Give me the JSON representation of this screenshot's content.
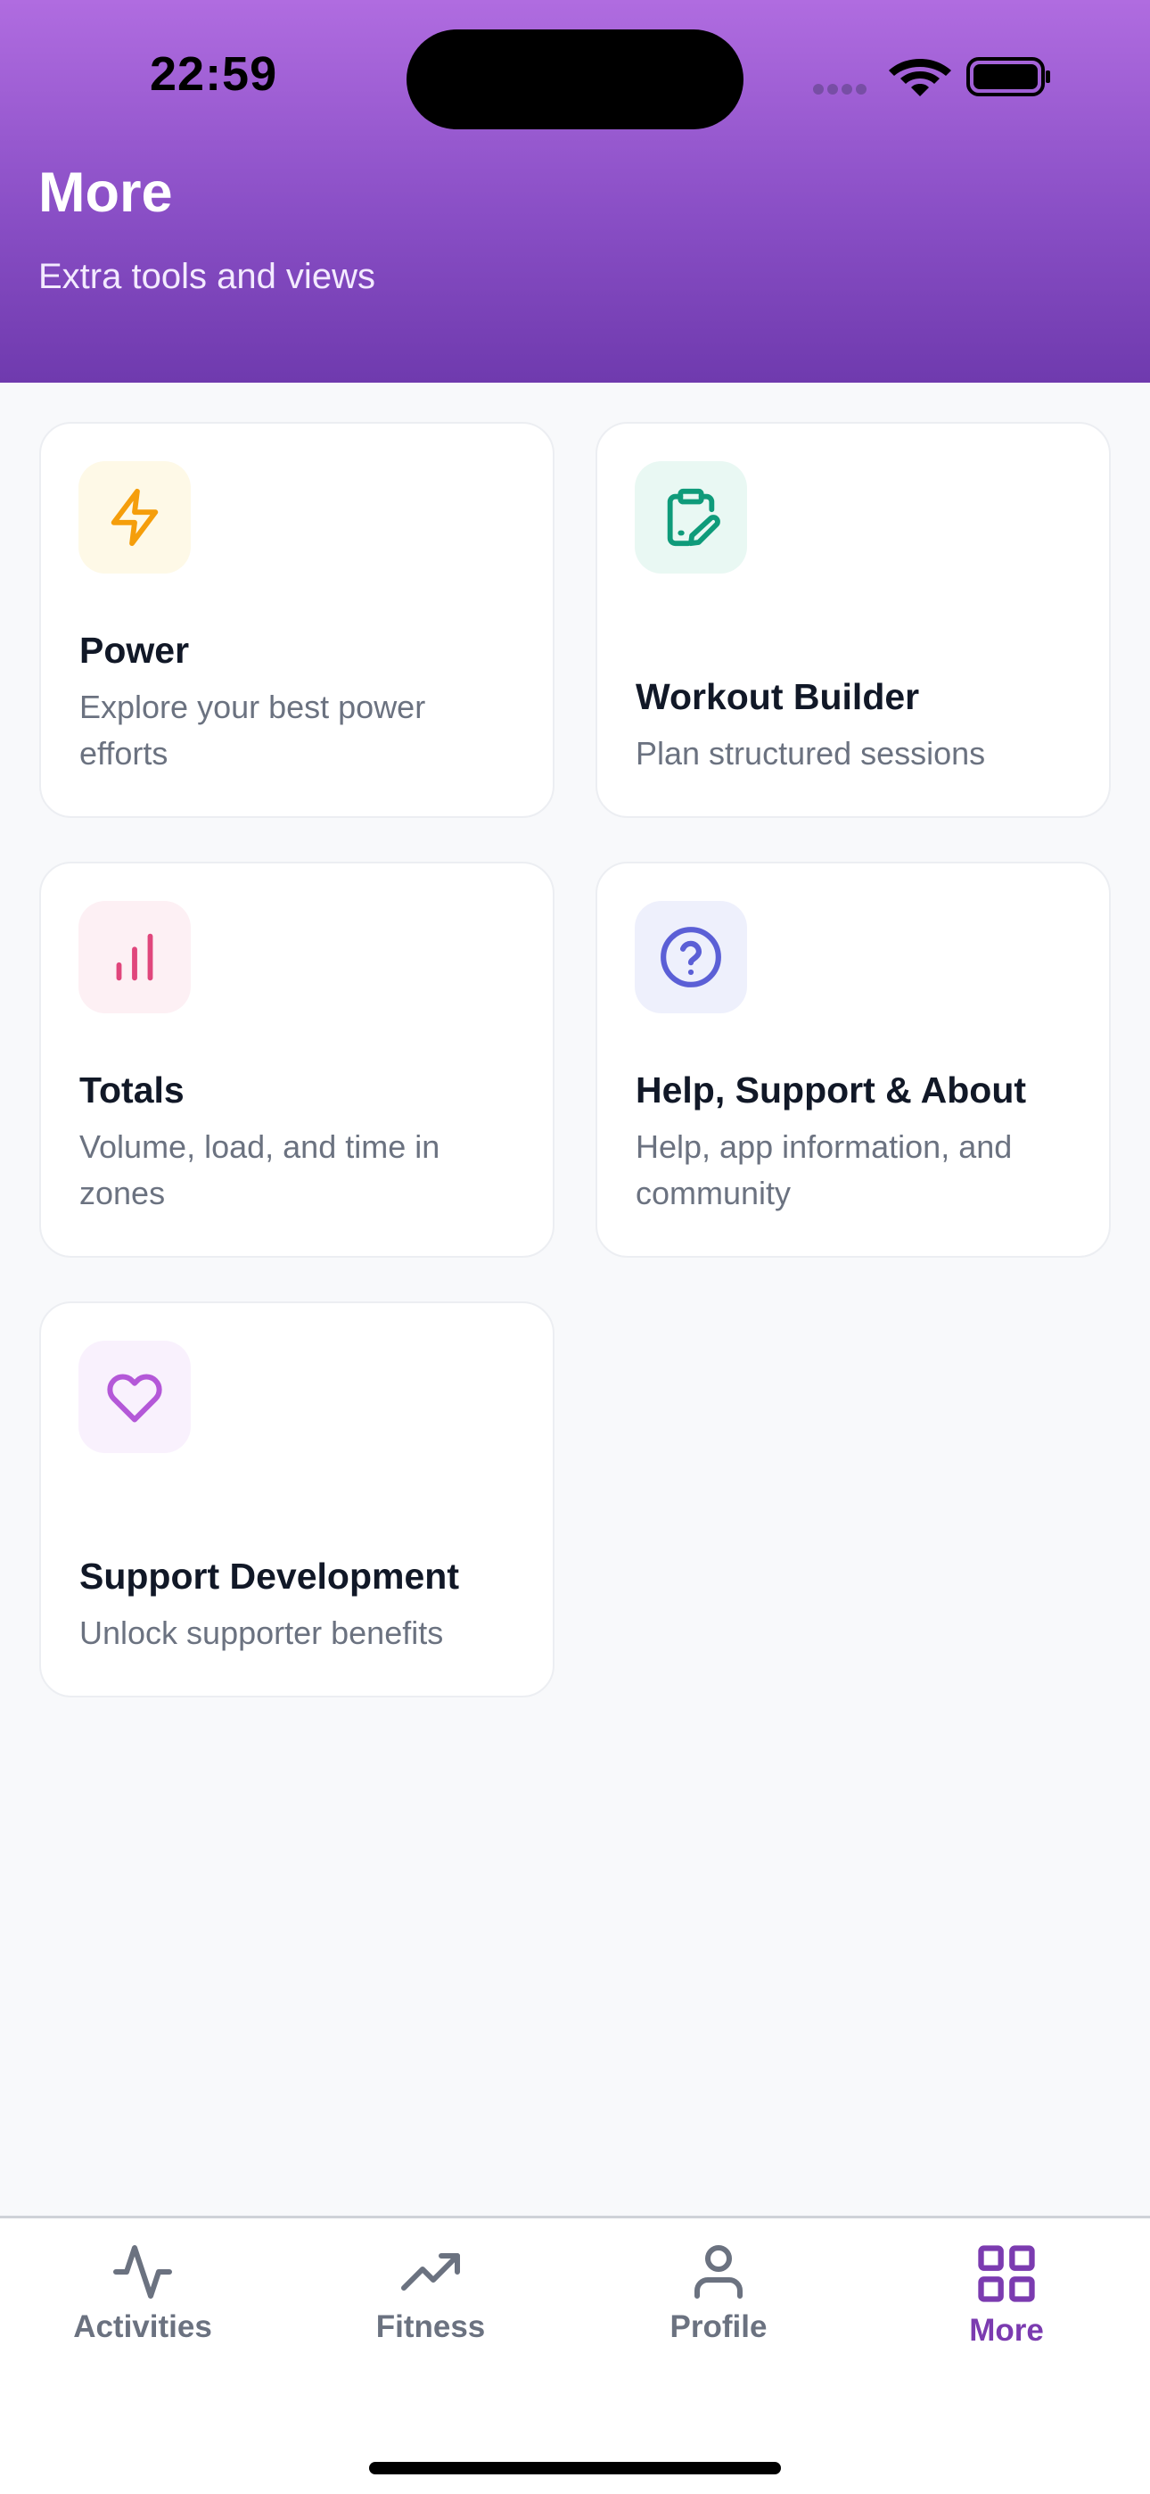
{
  "status_bar": {
    "time": "22:59"
  },
  "header": {
    "title": "More",
    "subtitle": "Extra tools and views"
  },
  "cards": [
    {
      "title": "Power",
      "description": "Explore your best power efforts",
      "icon": "lightning-icon",
      "icon_color": "#f59e0b",
      "icon_bg": "#fef9e7"
    },
    {
      "title": "Workout Builder",
      "description": "Plan structured sessions",
      "icon": "clipboard-edit-icon",
      "icon_color": "#0f9b7a",
      "icon_bg": "#e9f8f3"
    },
    {
      "title": "Totals",
      "description": "Volume, load, and time in zones",
      "icon": "bar-chart-icon",
      "icon_color": "#e0467c",
      "icon_bg": "#fdf0f4"
    },
    {
      "title": "Help, Support & About",
      "description": "Help, app information, and community",
      "icon": "question-circle-icon",
      "icon_color": "#5b5fd6",
      "icon_bg": "#eef0fc"
    },
    {
      "title": "Support Development",
      "description": "Unlock supporter benefits",
      "icon": "heart-icon",
      "icon_color": "#b458d8",
      "icon_bg": "#f9f1fd"
    }
  ],
  "tabbar": {
    "items": [
      {
        "label": "Activities",
        "icon": "activity-pulse-icon",
        "active": false
      },
      {
        "label": "Fitness",
        "icon": "trending-up-icon",
        "active": false
      },
      {
        "label": "Profile",
        "icon": "user-icon",
        "active": false
      },
      {
        "label": "More",
        "icon": "grid-icon",
        "active": true
      }
    ],
    "active_color": "#7b3bb0",
    "inactive_color": "#6b7280"
  }
}
